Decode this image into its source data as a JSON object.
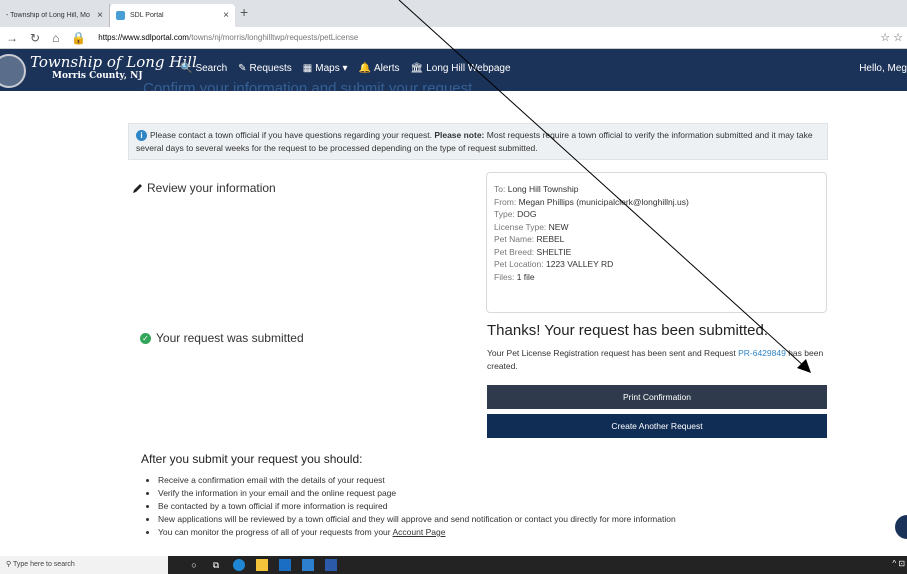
{
  "browser": {
    "tabs": [
      {
        "title": "- Township of Long Hill, Mo"
      },
      {
        "title": "SDL Portal"
      }
    ],
    "url_host": "https://www.sdlportal.com",
    "url_path": "/towns/nj/morris/longhilltwp/requests/petLicense"
  },
  "header": {
    "town": "Township of Long Hill",
    "county": "Morris County, NJ",
    "nav": [
      "Search",
      "Requests",
      "Maps ▾",
      "Alerts",
      "Long Hill Webpage"
    ],
    "greeting": "Hello, Meg",
    "page_title": "Confirm your information and submit your request"
  },
  "alert": {
    "text1": "Please contact a town official if you have questions regarding your request.",
    "note_label": "Please note:",
    "text2": "Most requests require a town official to verify the information submitted and it may take several days to several weeks for the request to be processed depending on the type of request submitted."
  },
  "review_label": "Review your information",
  "card": {
    "rows": [
      {
        "label": "To:",
        "value": "Long Hill Township"
      },
      {
        "label": "From:",
        "value": "Megan Phillips (municipalclerk@longhillnj.us)"
      },
      {
        "label": "Type:",
        "value": "DOG"
      },
      {
        "label": "License Type:",
        "value": "NEW"
      },
      {
        "label": "Pet Name:",
        "value": "REBEL"
      },
      {
        "label": "Pet Breed:",
        "value": "SHELTIE"
      },
      {
        "label": "Pet Location:",
        "value": "1223 VALLEY RD"
      },
      {
        "label": "Files:",
        "value": "1 file"
      }
    ]
  },
  "submitted_label": "Your request was submitted",
  "thanks": {
    "title": "Thanks! Your request has been submitted.",
    "body1": "Your Pet License Registration request has been sent and Request",
    "request_id": "PR-6429849",
    "body2": "has been created."
  },
  "buttons": {
    "print": "Print Confirmation",
    "create": "Create Another Request"
  },
  "after": {
    "title": "After you submit your request you should:",
    "items": [
      "Receive a confirmation email with the details of your request",
      "Verify the information in your email and the online request page",
      "Be contacted by a town official if more information is required",
      "New applications will be reviewed by a town official and they will approve and send notification or contact you directly for more information"
    ],
    "last_prefix": "You can monitor the progress of all of your requests from your",
    "last_link": "Account Page"
  },
  "taskbar": {
    "search_placeholder": "Type here to search"
  }
}
